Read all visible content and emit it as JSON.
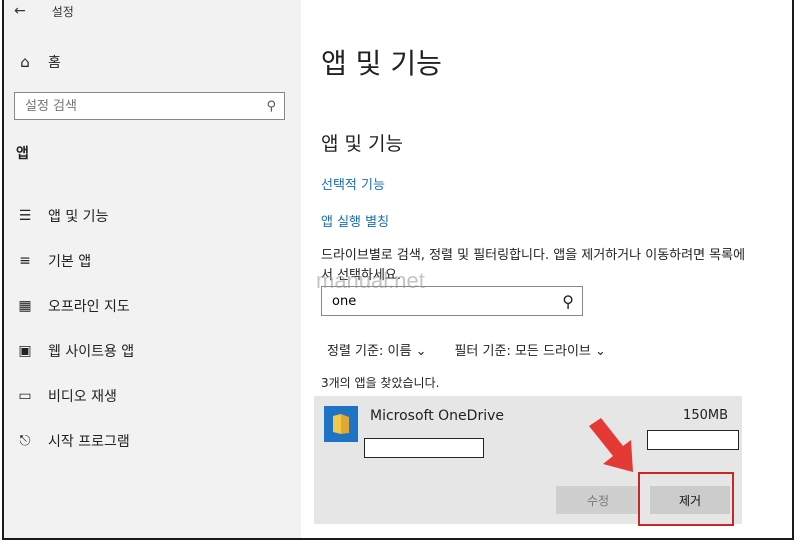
{
  "header": {
    "title": "설정"
  },
  "sidebar": {
    "home_label": "홈",
    "search_placeholder": "설정 검색",
    "section_title": "앱",
    "items": [
      {
        "label": "앱 및 기능",
        "icon": "apps-features-icon"
      },
      {
        "label": "기본 앱",
        "icon": "default-apps-icon"
      },
      {
        "label": "오프라인 지도",
        "icon": "offline-maps-icon"
      },
      {
        "label": "웹 사이트용 앱",
        "icon": "apps-for-websites-icon"
      },
      {
        "label": "비디오 재생",
        "icon": "video-playback-icon"
      },
      {
        "label": "시작 프로그램",
        "icon": "startup-icon"
      }
    ]
  },
  "main": {
    "page_title": "앱 및 기능",
    "section_title": "앱 및 기능",
    "link_optional": "선택적 기능",
    "link_aliases": "앱 실행 별칭",
    "description": "드라이브별로 검색, 정렬 및 필터링합니다. 앱을 제거하거나 이동하려면 목록에서 선택하세요.",
    "filter_value": "one",
    "sort_label": "정렬 기준:",
    "sort_value": "이름",
    "filter_label": "필터 기준:",
    "filter_drive": "모든 드라이브",
    "found_text": "3개의 앱을 찾았습니다.",
    "app": {
      "name": "Microsoft OneDrive",
      "size": "150MB",
      "modify_label": "수정",
      "remove_label": "제거"
    },
    "watermark": "manual.net"
  },
  "colors": {
    "accent_link": "#1a6fb5",
    "highlight": "#c62828",
    "arrow": "#e53935"
  }
}
